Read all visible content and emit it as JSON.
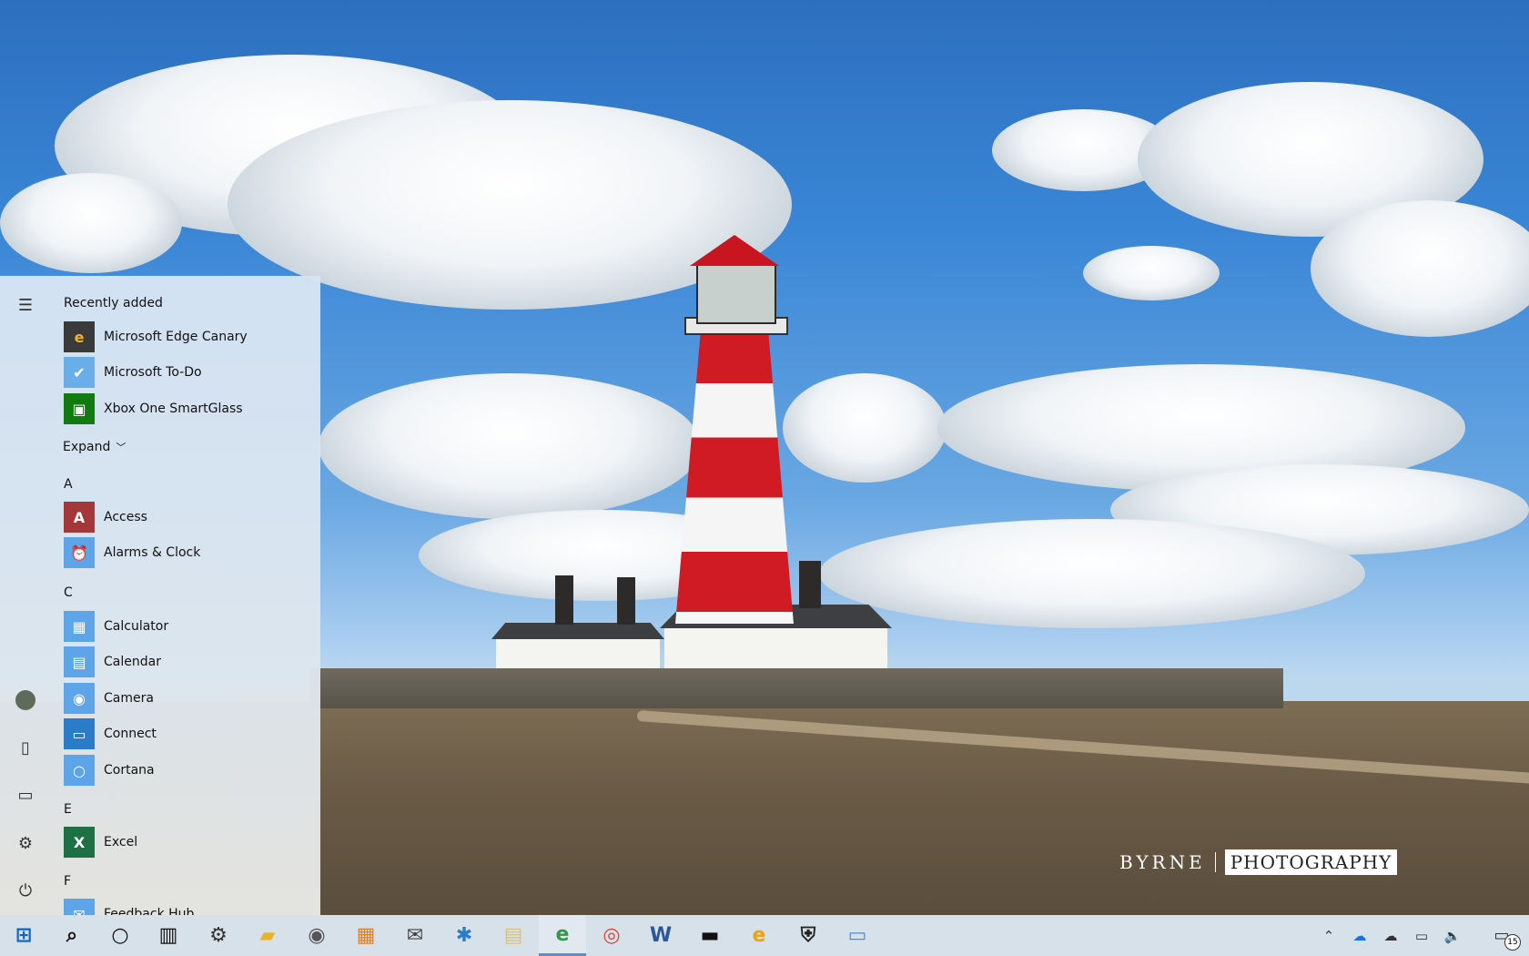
{
  "wallpaper": {
    "watermark_left": "BYRNE",
    "watermark_right": "PHOTOGRAPHY"
  },
  "start_menu": {
    "rail": [
      {
        "name": "hamburger",
        "glyph": "☰"
      },
      {
        "name": "user-avatar",
        "glyph": "●"
      },
      {
        "name": "documents",
        "glyph": "▯"
      },
      {
        "name": "pictures",
        "glyph": "▭"
      },
      {
        "name": "settings",
        "glyph": "⚙"
      },
      {
        "name": "power",
        "glyph": "⏻"
      }
    ],
    "recently_added_header": "Recently added",
    "recently_added": [
      {
        "label": "Microsoft Edge Canary",
        "icon": "edge-canary-icon",
        "color": "#3a3a3a",
        "glyph": "e"
      },
      {
        "label": "Microsoft To-Do",
        "icon": "todo-icon",
        "color": "#6aaee8",
        "glyph": "✔"
      },
      {
        "label": "Xbox One SmartGlass",
        "icon": "xbox-icon",
        "color": "#107c10",
        "glyph": "▣"
      }
    ],
    "expand_label": "Expand",
    "groups": [
      {
        "letter": "A",
        "apps": [
          {
            "label": "Access",
            "icon": "access-icon",
            "color": "#a4373a",
            "glyph": "A"
          },
          {
            "label": "Alarms & Clock",
            "icon": "alarm-clock-icon",
            "color": "#5ea4e8",
            "glyph": "⏰"
          }
        ]
      },
      {
        "letter": "C",
        "apps": [
          {
            "label": "Calculator",
            "icon": "calculator-icon",
            "color": "#5ea4e8",
            "glyph": "▦"
          },
          {
            "label": "Calendar",
            "icon": "calendar-icon",
            "color": "#5ea4e8",
            "glyph": "▤"
          },
          {
            "label": "Camera",
            "icon": "camera-icon",
            "color": "#5ea4e8",
            "glyph": "◉"
          },
          {
            "label": "Connect",
            "icon": "connect-icon",
            "color": "#2a7bc8",
            "glyph": "▭"
          },
          {
            "label": "Cortana",
            "icon": "cortana-icon",
            "color": "#5ea4e8",
            "glyph": "○"
          }
        ]
      },
      {
        "letter": "E",
        "apps": [
          {
            "label": "Excel",
            "icon": "excel-icon",
            "color": "#1e7145",
            "glyph": "X"
          }
        ]
      },
      {
        "letter": "F",
        "apps": [
          {
            "label": "Feedback Hub",
            "icon": "feedback-hub-icon",
            "color": "#5ea4e8",
            "glyph": "✉"
          }
        ]
      }
    ]
  },
  "taskbar": {
    "items": [
      {
        "name": "start",
        "glyph": "⊞",
        "color": "#0a64c8",
        "active": false
      },
      {
        "name": "search",
        "glyph": "⌕",
        "color": "#111111",
        "active": false
      },
      {
        "name": "cortana",
        "glyph": "○",
        "color": "#111111",
        "active": false
      },
      {
        "name": "task-view",
        "glyph": "▥",
        "color": "#111111",
        "active": false
      },
      {
        "name": "settings",
        "glyph": "⚙",
        "color": "#333333",
        "active": false
      },
      {
        "name": "file-explorer",
        "glyph": "▰",
        "color": "#e8b32a",
        "active": false
      },
      {
        "name": "camera",
        "glyph": "◉",
        "color": "#555555",
        "active": false
      },
      {
        "name": "store",
        "glyph": "▦",
        "color": "#e0802a",
        "active": false
      },
      {
        "name": "mail",
        "glyph": "✉",
        "color": "#444444",
        "active": false
      },
      {
        "name": "network-app",
        "glyph": "✱",
        "color": "#2a7bc8",
        "active": false
      },
      {
        "name": "notepad",
        "glyph": "▤",
        "color": "#d8c27a",
        "active": false
      },
      {
        "name": "edge-dev",
        "glyph": "e",
        "color": "#2f9a48",
        "active": true
      },
      {
        "name": "chrome",
        "glyph": "◎",
        "color": "#db4437",
        "active": false
      },
      {
        "name": "word",
        "glyph": "W",
        "color": "#2b579a",
        "active": false
      },
      {
        "name": "terminal",
        "glyph": "▬",
        "color": "#111111",
        "active": false
      },
      {
        "name": "edge-canary",
        "glyph": "e",
        "color": "#e8a317",
        "active": false
      },
      {
        "name": "windows-security",
        "glyph": "⛨",
        "color": "#222222",
        "active": false
      },
      {
        "name": "remote-desktop",
        "glyph": "▭",
        "color": "#4a90d9",
        "active": false
      }
    ],
    "tray": [
      {
        "name": "show-hidden-icons",
        "glyph": "⌃"
      },
      {
        "name": "onedrive-blue",
        "glyph": "☁"
      },
      {
        "name": "onedrive",
        "glyph": "☁"
      },
      {
        "name": "network",
        "glyph": "▭"
      },
      {
        "name": "volume",
        "glyph": "🔈"
      }
    ],
    "notification_count": "15"
  }
}
